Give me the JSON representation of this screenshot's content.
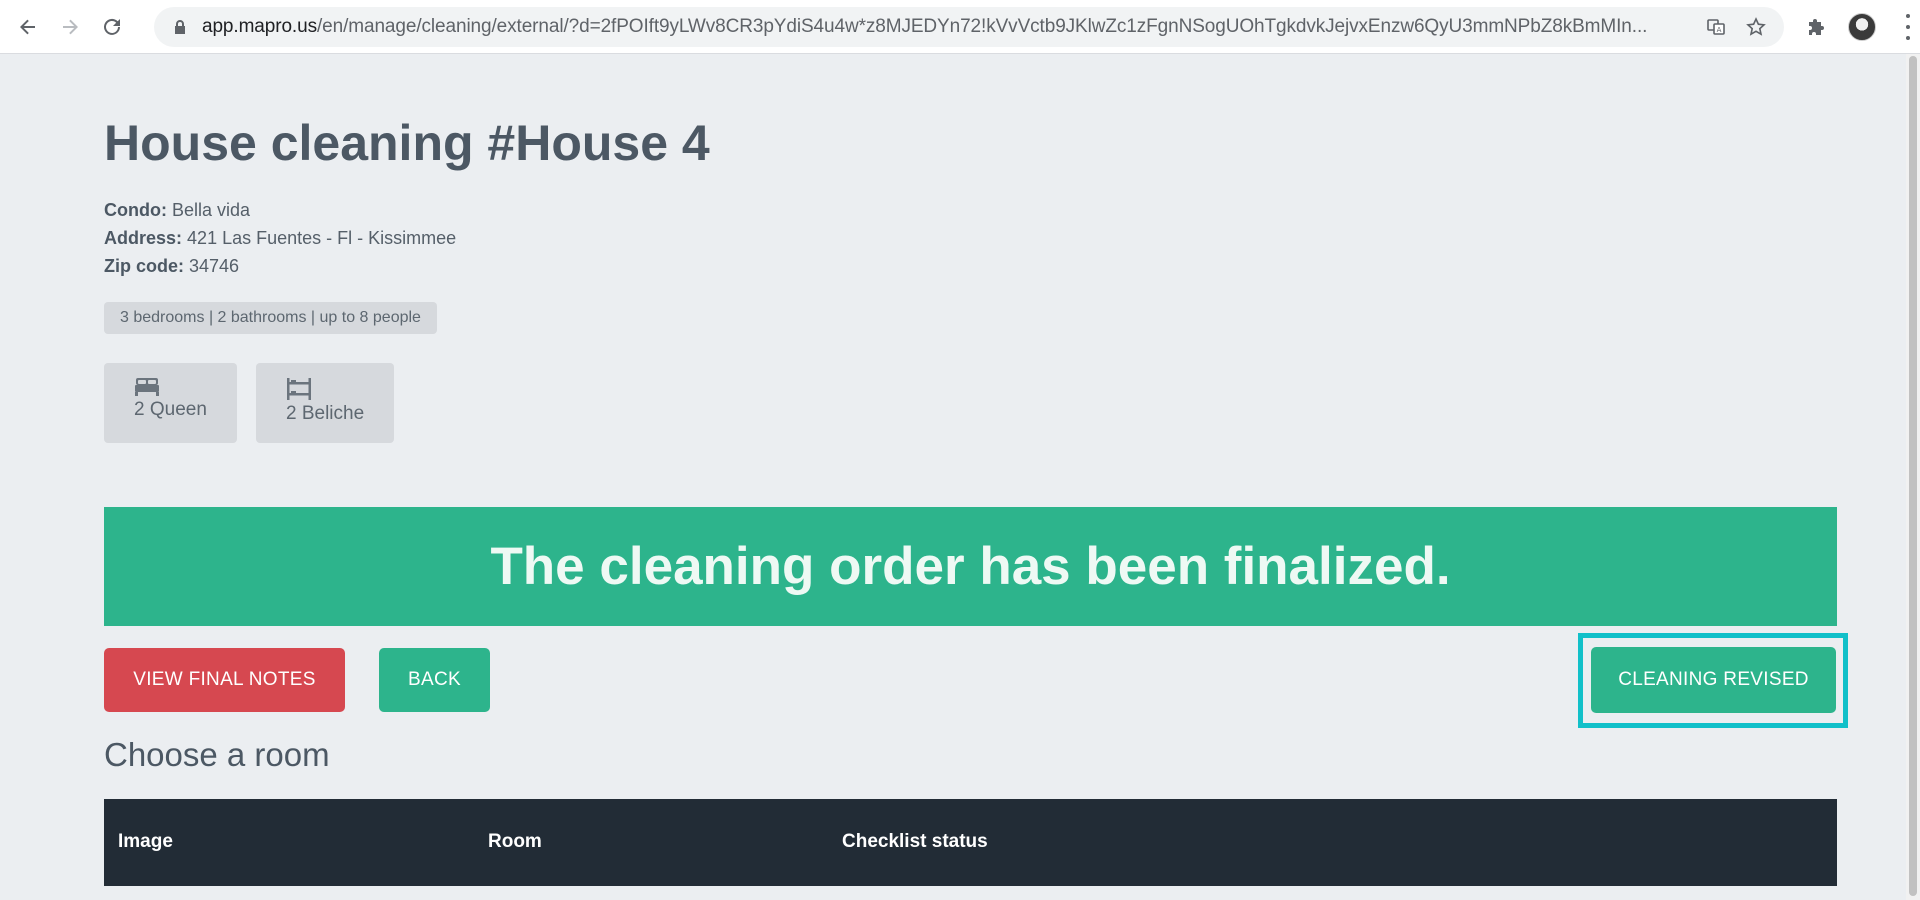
{
  "browser": {
    "url_host": "app.mapro.us",
    "url_path": "/en/manage/cleaning/external/?d=2fPOIft9yLWv8CR3pYdiS4u4w*z8MJEDYn72!kVvVctb9JKlwZc1zFgnNSogUOhTgkdvkJejvxEnzw6QyU3mmNPbZ8kBmMIn..."
  },
  "header": {
    "title": "House cleaning #House 4"
  },
  "details": {
    "condo_label": "Condo:",
    "condo_value": "Bella vida",
    "address_label": "Address:",
    "address_value": "421 Las Fuentes - Fl - Kissimmee",
    "zip_label": "Zip code:",
    "zip_value": "34746"
  },
  "summary_tag": "3 bedrooms | 2 bathrooms | up to 8 people",
  "beds": [
    {
      "label": "2 Queen",
      "icon": "bed-icon"
    },
    {
      "label": "2 Beliche",
      "icon": "bunk-bed-icon"
    }
  ],
  "banner": {
    "text": "The cleaning order has been finalized."
  },
  "actions": {
    "view_final_notes": "VIEW FINAL NOTES",
    "back": "BACK",
    "cleaning_revised": "CLEANING REVISED"
  },
  "rooms": {
    "title": "Choose a room",
    "columns": [
      "Image",
      "Room",
      "Checklist status"
    ]
  },
  "colors": {
    "accent_green": "#2db48c",
    "danger_red": "#d64850",
    "highlight_cyan": "#11c0c9",
    "table_header": "#222c36"
  }
}
